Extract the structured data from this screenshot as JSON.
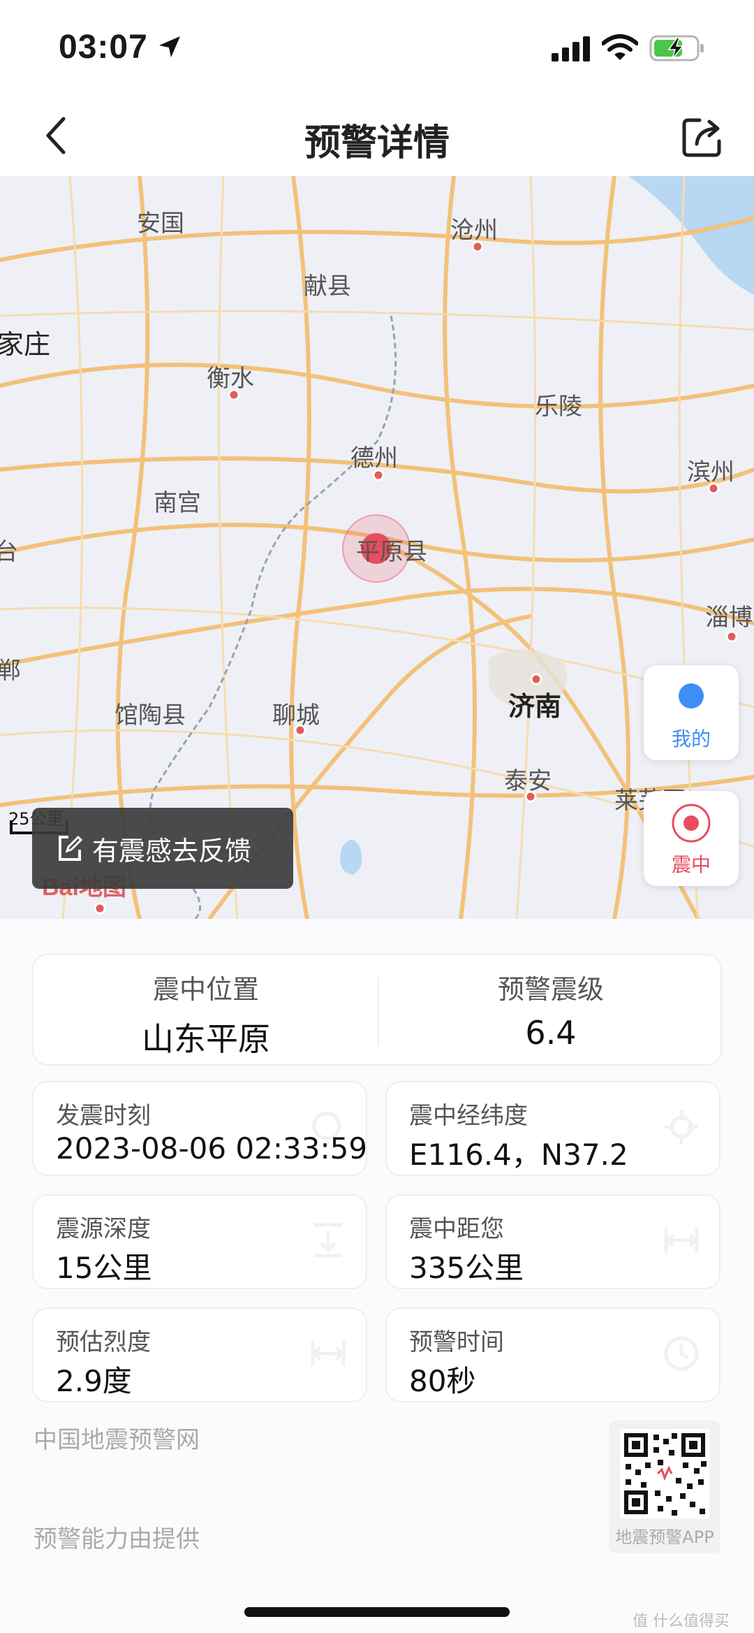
{
  "status_bar": {
    "time": "03:07"
  },
  "nav": {
    "title": "预警详情"
  },
  "map": {
    "cities": {
      "anguo": "安国",
      "cangzhou": "沧州",
      "xianxian": "献县",
      "jiazhuang": "家庄",
      "hengshui": "衡水",
      "leling": "乐陵",
      "dezhou": "德州",
      "binzhou": "滨州",
      "nangong": "南宫",
      "pingyuan": "平原县",
      "tai": "台",
      "zibo": "淄博",
      "han": "郸",
      "jinan": "济南",
      "guantao": "馆陶县",
      "liaocheng": "聊城",
      "taian": "泰安",
      "laiwu": "莱芜区"
    },
    "scale": "25公里",
    "logo": "Bai地图",
    "feedback_label": "有震感去反馈",
    "ctrl_mine_label": "我的",
    "ctrl_epicenter_label": "震中",
    "colors": {
      "mine": "#3f8ef5",
      "epicenter": "#e84c5e"
    }
  },
  "summary": {
    "location_label": "震中位置",
    "location_value": "山东平原",
    "magnitude_label": "预警震级",
    "magnitude_value": "6.4"
  },
  "details": {
    "time_label": "发震时刻",
    "time_value": "2023-08-06 02:33:59",
    "coords_label": "震中经纬度",
    "coords_value": "E116.4，N37.2",
    "depth_label": "震源深度",
    "depth_value": "15公里",
    "distance_label": "震中距您",
    "distance_value": "335公里",
    "intensity_label": "预估烈度",
    "intensity_value": "2.9度",
    "warning_label": "预警时间",
    "warning_value": "80秒"
  },
  "footer": {
    "network": "中国地震预警网",
    "provider": "预警能力由提供",
    "qr_caption": "地震预警APP"
  },
  "watermark": "值 什么值得买"
}
